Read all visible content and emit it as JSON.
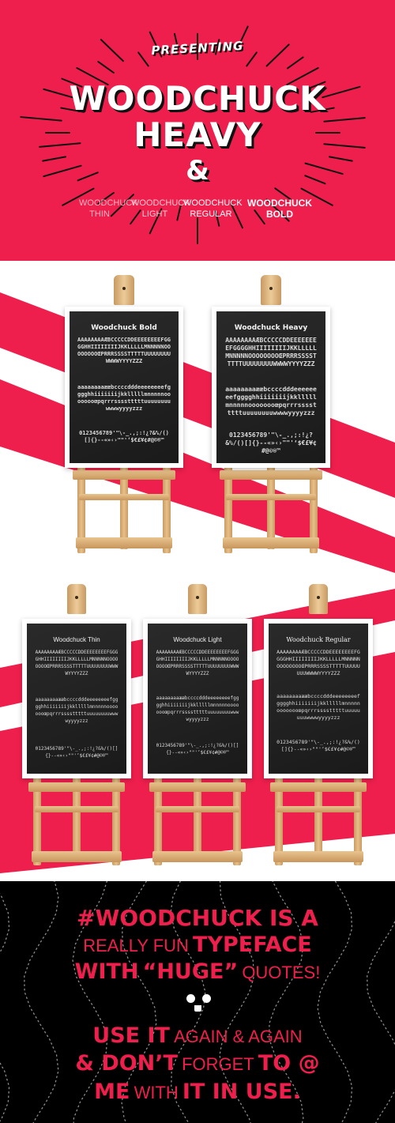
{
  "hero": {
    "presenting": "PRESENTING",
    "title_line1": "WOODCHUCK",
    "title_line2": "HEAVY",
    "ampersand": "&",
    "weights": [
      {
        "line1": "WOODCHUCK",
        "line2": "THIN"
      },
      {
        "line1": "WOODCHUCK",
        "line2": "LIGHT"
      },
      {
        "line1": "WOODCHUCK",
        "line2": "REGULAR"
      },
      {
        "line1": "WOODCHUCK",
        "line2": "BOLD"
      }
    ],
    "bg_color": "#ee1f4c"
  },
  "boards": [
    {
      "title": "Woodchuck Bold"
    },
    {
      "title": "Woodchuck Heavy"
    },
    {
      "title": "Woodchuck Thin"
    },
    {
      "title": "Woodchuck Light"
    },
    {
      "title": "Woodchuck Regular"
    }
  ],
  "glyph_sets": {
    "upper": "AAAAAAAAÆBCCCCCDDEEEEEEEEFGGGGHHIIIIIIIIJKKLLLLLMNNNNNOOOOOOOOŒPRRRSSSSTTTTTUUUUUUUUWWWWYYYYZZZ",
    "lower": "aaaaaaaaææbccccdddeeeeeeeefgggghhiiiiiiijkklllllmnnnnnoooooooœpqrrrsssstttttuuuuuuuuwwwwyyyyzzz",
    "figures": "0123456789'\"\\-_.,;:!¿?&%/()[]{}--«»‹›\"\"'‘$€£¥¢#@©®™"
  },
  "bottom": {
    "line1_heavy": "#WOODCHUCK IS A",
    "line2_thin": "REALLY FUN",
    "line2_heavy": "TYPEFACE",
    "line3_heavy1": "WITH",
    "line3_heavy2": "“HUGE”",
    "line3_thin": "QUOTES!",
    "line4_heavy": "USE IT",
    "line4_thin": "AGAIN & AGAIN",
    "line5_heavy1": "& DON’T",
    "line5_thin": "FORGET",
    "line5_heavy2": "TO @",
    "line6_heavy1": "ME",
    "line6_thin": "WITH",
    "line6_heavy2": "IT IN USE.",
    "accent": "#ee1f4c"
  }
}
